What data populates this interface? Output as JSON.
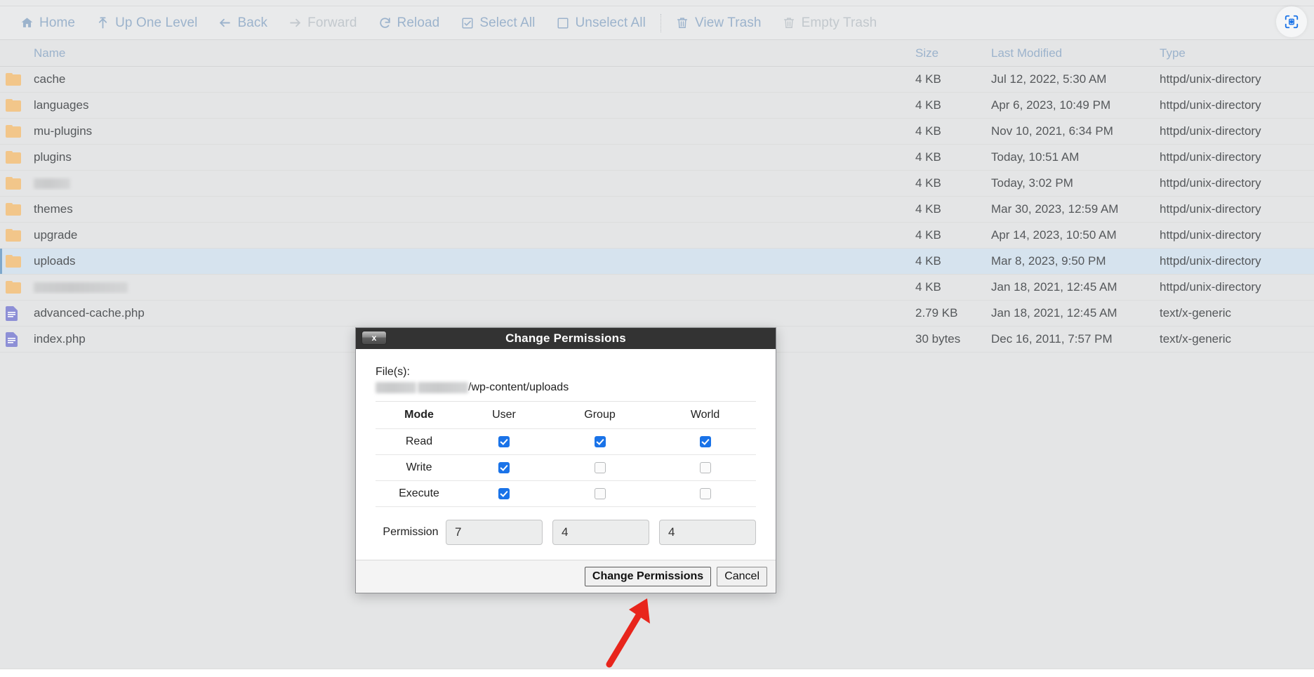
{
  "window": {
    "screenshot_badge_icon": "camera-focus-icon"
  },
  "toolbar": {
    "items": [
      {
        "label": "Home",
        "icon": "home-icon",
        "disabled": false
      },
      {
        "label": "Up One Level",
        "icon": "arrow-up-icon",
        "disabled": false
      },
      {
        "label": "Back",
        "icon": "arrow-left-icon",
        "disabled": false
      },
      {
        "label": "Forward",
        "icon": "arrow-right-icon",
        "disabled": true
      },
      {
        "label": "Reload",
        "icon": "reload-icon",
        "disabled": false
      },
      {
        "label": "Select All",
        "icon": "checkbox-checked-icon",
        "disabled": false
      },
      {
        "label": "Unselect All",
        "icon": "checkbox-empty-icon",
        "disabled": false
      },
      {
        "label": "View Trash",
        "icon": "trash-icon",
        "disabled": false
      },
      {
        "label": "Empty Trash",
        "icon": "trash-icon",
        "disabled": true
      }
    ],
    "accent_color": "#9cb3cc",
    "disabled_color": "#c2c8cd"
  },
  "filelist": {
    "columns": [
      "Name",
      "Size",
      "Last Modified",
      "Type"
    ],
    "rows": [
      {
        "icon": "folder-icon",
        "name": "cache",
        "redacted": false,
        "size": "4 KB",
        "modified": "Jul 12, 2022, 5:30 AM",
        "type": "httpd/unix-directory",
        "selected": false
      },
      {
        "icon": "folder-icon",
        "name": "languages",
        "redacted": false,
        "size": "4 KB",
        "modified": "Apr 6, 2023, 10:49 PM",
        "type": "httpd/unix-directory",
        "selected": false
      },
      {
        "icon": "folder-icon",
        "name": "mu-plugins",
        "redacted": false,
        "size": "4 KB",
        "modified": "Nov 10, 2021, 6:34 PM",
        "type": "httpd/unix-directory",
        "selected": false
      },
      {
        "icon": "folder-icon",
        "name": "plugins",
        "redacted": false,
        "size": "4 KB",
        "modified": "Today, 10:51 AM",
        "type": "httpd/unix-directory",
        "selected": false
      },
      {
        "icon": "folder-icon",
        "name": "",
        "redacted": true,
        "redact_width": "w1",
        "size": "4 KB",
        "modified": "Today, 3:02 PM",
        "type": "httpd/unix-directory",
        "selected": false
      },
      {
        "icon": "folder-icon",
        "name": "themes",
        "redacted": false,
        "size": "4 KB",
        "modified": "Mar 30, 2023, 12:59 AM",
        "type": "httpd/unix-directory",
        "selected": false
      },
      {
        "icon": "folder-icon",
        "name": "upgrade",
        "redacted": false,
        "size": "4 KB",
        "modified": "Apr 14, 2023, 10:50 AM",
        "type": "httpd/unix-directory",
        "selected": false
      },
      {
        "icon": "folder-icon",
        "name": "uploads",
        "redacted": false,
        "size": "4 KB",
        "modified": "Mar 8, 2023, 9:50 PM",
        "type": "httpd/unix-directory",
        "selected": true
      },
      {
        "icon": "folder-icon",
        "name": "",
        "redacted": true,
        "redact_width": "w2",
        "size": "4 KB",
        "modified": "Jan 18, 2021, 12:45 AM",
        "type": "httpd/unix-directory",
        "selected": false
      },
      {
        "icon": "file-icon",
        "name": "advanced-cache.php",
        "redacted": false,
        "size": "2.79 KB",
        "modified": "Jan 18, 2021, 12:45 AM",
        "type": "text/x-generic",
        "selected": false
      },
      {
        "icon": "file-icon",
        "name": "index.php",
        "redacted": false,
        "size": "30 bytes",
        "modified": "Dec 16, 2011, 7:57 PM",
        "type": "text/x-generic",
        "selected": false
      }
    ]
  },
  "dialog": {
    "title": "Change Permissions",
    "close_label": "x",
    "files_label": "File(s):",
    "path_suffix": "/wp-content/uploads",
    "path_redacted": true,
    "table": {
      "headers": [
        "Mode",
        "User",
        "Group",
        "World"
      ],
      "rows": [
        {
          "mode": "Read",
          "user": true,
          "group": true,
          "world": true
        },
        {
          "mode": "Write",
          "user": true,
          "group": false,
          "world": false
        },
        {
          "mode": "Execute",
          "user": true,
          "group": false,
          "world": false
        }
      ]
    },
    "permission_label": "Permission",
    "permission_values": {
      "user": "7",
      "group": "4",
      "world": "4"
    },
    "buttons": {
      "confirm": "Change Permissions",
      "cancel": "Cancel"
    },
    "checked_color": "#1a73e8"
  },
  "annotation": {
    "arrow_color": "#e8251c"
  }
}
